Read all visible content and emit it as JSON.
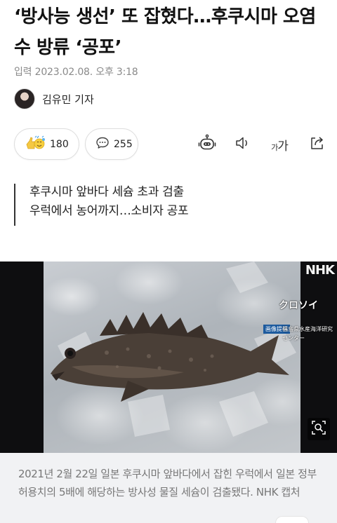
{
  "article": {
    "headline": "‘방사능 생선’ 또 잡혔다…후쿠시마 오염수 방류 ‘공포’",
    "published": "입력 2023.02.08. 오후 3:18",
    "author": "김유민 기자"
  },
  "reactions": {
    "like_count": "180",
    "comment_count": "255"
  },
  "tools": {
    "font_size_label_small": "가",
    "font_size_label_large": "가"
  },
  "summary": {
    "lines": [
      "후쿠시마 앞바다 세슘 초과 검출",
      "우럭에서 농어까지…소비자 공포"
    ]
  },
  "photo": {
    "broadcaster": "NHK",
    "fish_name": "クロソイ",
    "credit_tag": "画像提供",
    "credit_text": "福島県水産海洋研究センター",
    "caption": "2021년 2월 22일 일본 후쿠시마 앞바다에서 잡힌 우럭에서 일본 정부 허용치의 5배에 해당하는 방사성 물질 세슘이 검출됐다. NHK 캡처"
  },
  "colors": {
    "text": "#111111",
    "muted": "#8a8a8a",
    "caption_bg": "#f1f2f4"
  },
  "icons": [
    "emoji-reaction-icon",
    "comment-icon",
    "summary-bot-icon",
    "text-to-speech-icon",
    "font-size-icon",
    "share-icon",
    "zoom-icon"
  ]
}
